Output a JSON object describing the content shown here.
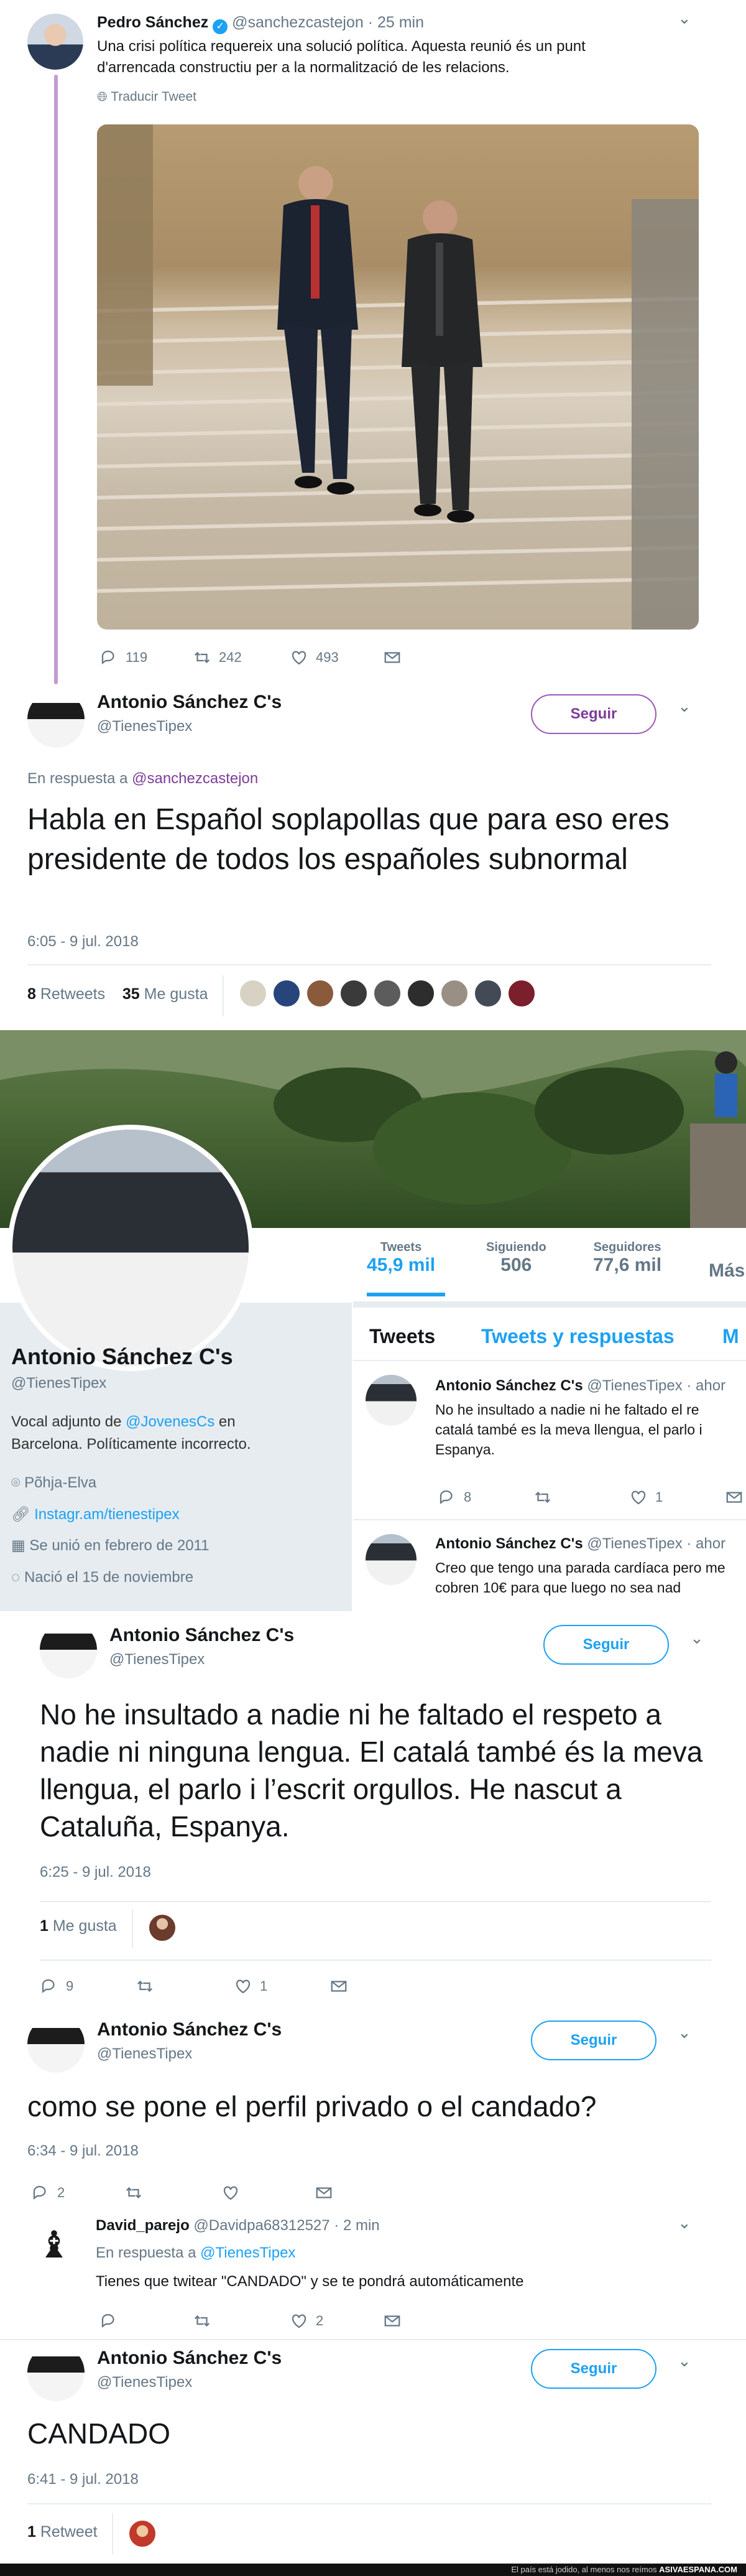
{
  "tweet1": {
    "name": "Pedro Sánchez",
    "handle": "@sanchezcastejon",
    "time": "· 25 min",
    "text": "Una crisi política requereix una solució política. Aquesta reunió és un punt d'arrencada constructiu per a la normalització de les relacions.",
    "translate": "Traducir Tweet",
    "replies": "119",
    "retweets": "242",
    "likes": "493"
  },
  "reply1": {
    "name": "Antonio Sánchez C's",
    "handle": "@TienesTipex",
    "follow": "Seguir",
    "in_reply_prefix": "En respuesta a",
    "in_reply_to": "@sanchezcastejon",
    "text": "Habla en Español soplapollas que para eso eres presidente de todos los españoles subnormal",
    "timestamp": "6:05 - 9 jul. 2018",
    "retweets_count": "8",
    "retweets_label": "Retweets",
    "likes_count": "35",
    "likes_label": "Me gusta"
  },
  "profile": {
    "name": "Antonio Sánchez C's",
    "handle": "@TienesTipex",
    "bio_prefix": "Vocal adjunto de",
    "bio_mention": "@JovenesCs",
    "bio_suffix": "en Barcelona. Políticamente incorrecto.",
    "location": "Põhja-Elva",
    "website": "Instagr.am/tienestipex",
    "joined": "Se unió en febrero de 2011",
    "birthday": "Nació el 15 de noviembre",
    "stats": [
      {
        "label": "Tweets",
        "value": "45,9 mil"
      },
      {
        "label": "Siguiendo",
        "value": "506"
      },
      {
        "label": "Seguidores",
        "value": "77,6 mil"
      },
      {
        "label": "Más"
      }
    ],
    "tabs": [
      "Tweets",
      "Tweets y respuestas",
      "M"
    ],
    "feed": [
      {
        "name": "Antonio Sánchez C's",
        "handle": "@TienesTipex",
        "time": "· ahor",
        "text": "No he insultado a nadie ni he faltado el re catalá també es la meva llengua, el parlo i Espanya.",
        "replies": "8",
        "likes": "1"
      },
      {
        "name": "Antonio Sánchez C's",
        "handle": "@TienesTipex",
        "time": "· ahor",
        "text": "Creo que tengo una parada cardíaca pero me cobren 10€ para que luego no sea nad"
      }
    ]
  },
  "tweet3": {
    "name": "Antonio Sánchez C's",
    "handle": "@TienesTipex",
    "follow": "Seguir",
    "text": "No he insultado a nadie ni he faltado el respeto a nadie ni ninguna lengua. El catalá també és la meva llengua, el parlo i l’escrit orgullos. He nascut a Cataluña, Espanya.",
    "timestamp": "6:25 - 9 jul. 2018",
    "likes_count": "1",
    "likes_label": "Me gusta",
    "replies": "9",
    "likes": "1"
  },
  "tweet4": {
    "name": "Antonio Sánchez C's",
    "handle": "@TienesTipex",
    "follow": "Seguir",
    "text": "como se pone el perfil privado o el candado?",
    "timestamp": "6:34 - 9 jul. 2018",
    "replies": "2"
  },
  "reply_david": {
    "name": "David_parejo",
    "handle": "@Davidpa68312527",
    "time": "· 2 min",
    "in_reply_prefix": "En respuesta a",
    "in_reply_to": "@TienesTipex",
    "text": "Tienes que twitear \"CANDADO\" y se te pondrá automáticamente",
    "likes": "2"
  },
  "tweet5": {
    "name": "Antonio Sánchez C's",
    "handle": "@TienesTipex",
    "follow": "Seguir",
    "text": "CANDADO",
    "timestamp": "6:41 - 9 jul. 2018",
    "retweets_count": "1",
    "retweets_label": "Retweet"
  },
  "footer": {
    "text": "El país está jodido, al menos nos reímos",
    "brand": "ASIVAESPANA.COM"
  },
  "colors": {
    "accent": "#1da1f2",
    "thread_line": "#c39bd3",
    "text": "#14171a",
    "muted": "#657786"
  }
}
